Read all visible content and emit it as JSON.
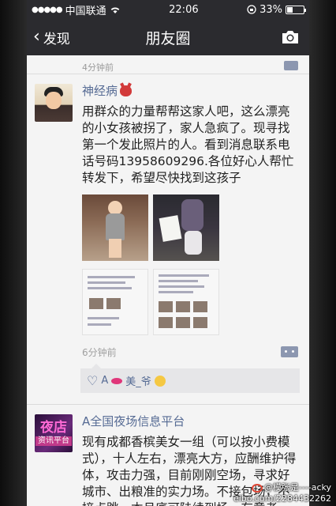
{
  "status_bar": {
    "signal": "●●●●●",
    "carrier": "中国联通",
    "time": "22:06",
    "battery": "33%"
  },
  "nav": {
    "back_label": "发现",
    "title": "朋友圈"
  },
  "prev_post_time": "4分钟前",
  "posts": [
    {
      "nickname": "神经病",
      "text": "用群众的力量帮帮这家人吧，这么漂亮的小女孩被拐了，家人急疯了。现寻找第一个发此照片的人。看到消息联系电话号码13958609296.各位好心人帮忙转发下，希望尽快找到这孩子",
      "time": "6分钟前",
      "likes": "A",
      "likes_suffix": "美_爷"
    },
    {
      "nickname": "A全国夜场信息平台",
      "avatar_text_1": "夜店",
      "avatar_text_2": "资讯平台",
      "text": "现有成都香槟美女一组（可以按小费模式），十人左右，漂亮大方，应酬维护得体，攻击力强，目前刚刚空场，寻求好城市、出粮准的实力场。不接包场，不接点跳。本月底可陆续到场。有意者"
    }
  ],
  "watermark": {
    "line1": "@模张是----acky",
    "line2": "eibo.com/2284432262"
  },
  "colors": {
    "nav_bg": "#2b2b2f",
    "link_blue": "#566b94",
    "feed_bg": "#f4f4f4"
  }
}
